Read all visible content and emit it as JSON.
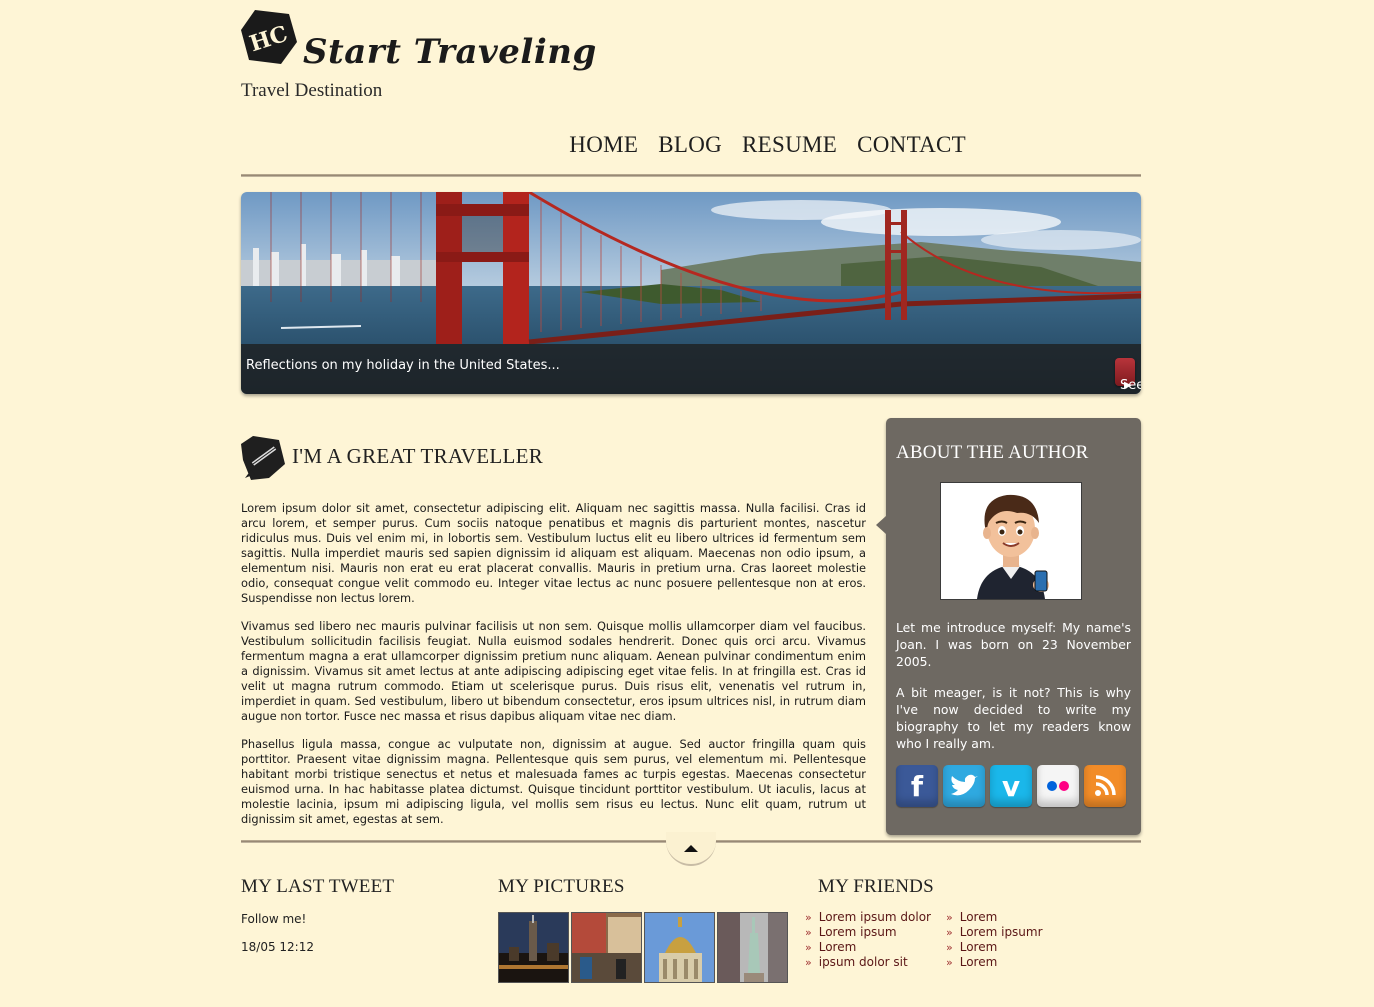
{
  "site": {
    "logo_badge": "HC",
    "title": "Start Traveling",
    "tagline": "Travel Destination"
  },
  "nav": [
    "HOME",
    "BLOG",
    "RESUME",
    "CONTACT"
  ],
  "banner": {
    "caption": "Reflections on my holiday in the United States...",
    "button": "See article"
  },
  "article": {
    "title": "I'M A GREAT TRAVELLER",
    "paragraphs": [
      "Lorem ipsum dolor sit amet, consectetur adipiscing elit. Aliquam nec sagittis massa. Nulla facilisi. Cras id arcu lorem, et semper purus. Cum sociis natoque penatibus et magnis dis parturient montes, nascetur ridiculus mus. Duis vel enim mi, in lobortis sem. Vestibulum luctus elit eu libero ultrices id fermentum sem sagittis. Nulla imperdiet mauris sed sapien dignissim id aliquam est aliquam. Maecenas non odio ipsum, a elementum nisi. Mauris non erat eu erat placerat convallis. Mauris in pretium urna. Cras laoreet molestie odio, consequat congue velit commodo eu. Integer vitae lectus ac nunc posuere pellentesque non at eros. Suspendisse non lectus lorem.",
      "Vivamus sed libero nec mauris pulvinar facilisis ut non sem. Quisque mollis ullamcorper diam vel faucibus. Vestibulum sollicitudin facilisis feugiat. Nulla euismod sodales hendrerit. Donec quis orci arcu. Vivamus fermentum magna a erat ullamcorper dignissim pretium nunc aliquam. Aenean pulvinar condimentum enim a dignissim. Vivamus sit amet lectus at ante adipiscing adipiscing eget vitae felis. In at fringilla est. Cras id velit ut magna rutrum commodo. Etiam ut scelerisque purus. Duis risus elit, venenatis vel rutrum in, imperdiet in quam. Sed vestibulum, libero ut bibendum consectetur, eros ipsum ultrices nisl, in rutrum diam augue non tortor. Fusce nec massa et risus dapibus aliquam vitae nec diam.",
      "Phasellus ligula massa, congue ac vulputate non, dignissim at augue. Sed auctor fringilla quam quis porttitor. Praesent vitae dignissim magna. Pellentesque quis sem purus, vel elementum mi. Pellentesque habitant morbi tristique senectus et netus et malesuada fames ac turpis egestas. Maecenas consectetur euismod urna. In hac habitasse platea dictumst. Quisque tincidunt porttitor vestibulum. Ut iaculis, lacus at molestie lacinia, ipsum mi adipiscing ligula, vel mollis sem risus eu lectus. Nunc elit quam, rutrum ut dignissim sit amet, egestas at sem."
    ]
  },
  "sidebar": {
    "title": "ABOUT THE AUTHOR",
    "p1": "Let me introduce myself: My name's Joan. I was born on 23 November 2005.",
    "p2": "A bit meager, is it not? This is why I've now decided to write my biography to let my readers know who I really am.",
    "social": [
      {
        "name": "facebook-icon",
        "glyph": "f",
        "color": "#3b5998"
      },
      {
        "name": "twitter-icon",
        "glyph": "t",
        "color": "#2fa9e0"
      },
      {
        "name": "vimeo-icon",
        "glyph": "v",
        "color": "#1ab7ea"
      },
      {
        "name": "flickr-icon",
        "glyph": "",
        "color": "#f5f5f5"
      },
      {
        "name": "rss-icon",
        "glyph": "",
        "color": "#f28c28"
      }
    ]
  },
  "footer": {
    "tweet": {
      "title": "MY LAST TWEET",
      "text": "Follow me!",
      "time": "18/05 12:12"
    },
    "pictures": {
      "title": "MY PICTURES"
    },
    "friends": {
      "title": "MY FRIENDS",
      "col1": [
        "Lorem ipsum dolor",
        "Lorem ipsum",
        "Lorem",
        "ipsum dolor sit"
      ],
      "col2": [
        "Lorem",
        "Lorem ipsumr",
        "Lorem",
        "Lorem"
      ]
    }
  }
}
